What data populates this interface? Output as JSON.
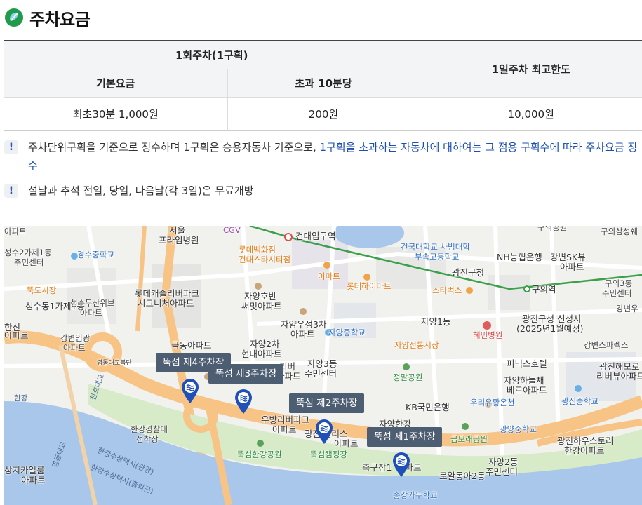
{
  "header": {
    "title": "주차요금"
  },
  "fee_table": {
    "group_header": "1회주차(1구획)",
    "daily_max_header": "1일주차 최고한도",
    "basic_fee_header": "기본요금",
    "extra_fee_header": "초과 10분당",
    "basic_fee_value": "최초30분 1,000원",
    "extra_fee_value": "200원",
    "daily_max_value": "10,000원"
  },
  "notes": {
    "note1_text": "주차단위구획을 기준으로 징수하며 1구획은 승용자동차 기준으로, ",
    "note1_highlight": "1구획을 초과하는 자동차에 대하여는 그 점용 구획수에 따라 주차요금 징수",
    "note2_text": "설날과 추석 전일, 당일, 다음날(각 3일)은 무료개방",
    "icon": "exclamation-icon"
  },
  "map": {
    "parking_lots": [
      "뚝섬 제4주차장",
      "뚝섬 제3주차장",
      "뚝섬 제2주차장",
      "뚝섬 제1주차장"
    ],
    "labels": {
      "l1": "아파트",
      "l2": "서울",
      "l3": "프라임병원",
      "l4": "CGV",
      "l5": "건대입구역",
      "l6": "구의공원",
      "l7": "구의삼성쉐",
      "l8": "성수2가제1동",
      "l9": "주민센터",
      "l10": "경수중학교",
      "l11": "롯데백화점",
      "l12": "건대스타시티점",
      "l13": "건국대학교 사범대학",
      "l14": "부속고등학교",
      "l15": "NH농협은행",
      "l16": "강변SK뷰",
      "l17": "아파트",
      "l18": "광진구청",
      "l19": "이마트",
      "l20": "롯데하이마트",
      "l21": "뚝도시장",
      "l22": "롯데캐슬리버파크",
      "l23": "시그니처아파트",
      "l24": "자양호반",
      "l25": "써밋아파트",
      "l26": "스타벅스",
      "l27": "구의역",
      "l28": "구의3동",
      "l29": "주민센터",
      "l30": "성수동1가제1동",
      "l31": "성수두산위브",
      "l32": "아파트",
      "l33": "강변우",
      "l34": "자양우성3차",
      "l35": "아파트",
      "l36": "자양1동",
      "l37": "광진구청 신청사",
      "l38": "(2025년1월예정)",
      "l39": "강변임광",
      "l40": "아파트",
      "l41": "자양중학교",
      "l42": "혜민병원",
      "l43": "극동아파트",
      "l44": "자양2차",
      "l45": "현대아파트",
      "l46": "자양전통시장",
      "l47": "강변스파렉스",
      "l48": "영동대교북단",
      "l49": "자양3동",
      "l50": "주민센터",
      "l51": "리버",
      "l52": "아파트",
      "l53": "피닉스호텔",
      "l54": "광진해모로",
      "l55": "리버뷰아파트",
      "l56": "자양하늘채",
      "l57": "베르아파트",
      "l58": "정말공원",
      "l59": "KB국민은행",
      "l60": "우리유황온천",
      "l61": "광진중학교",
      "l62": "우방리버파크",
      "l63": "아파트",
      "l64": "광진 플러스",
      "l65": "아파트",
      "l66": "한강경찰대",
      "l67": "선착장",
      "l68": "광양중학교",
      "l69": "금모래공원",
      "l70": "광진하우스토리",
      "l71": "한강아파트",
      "l72": "뚝섬한강공원",
      "l73": "뚝섬캠핑장",
      "l74": "축구장1",
      "l75": "자양2동",
      "l76": "주민센터",
      "l77": "로얄동아2동",
      "l78": "상지카일룸",
      "l79": "아파트",
      "l80": "한강수상택시(관광)",
      "l81": "한강수상택시(출퇴근)",
      "l82": "송강카누학교",
      "l83": "한강",
      "l84": "자양한강",
      "l85": "천호대교",
      "l86": "영동대교",
      "l87": "아파트",
      "l88": "한신",
      "l89": "아파트"
    }
  },
  "colors": {
    "accent_blue": "#1d4fb3",
    "map_road": "#f7c486",
    "map_river": "#a8c7ea",
    "map_park": "#d7ebc8",
    "pin_blue": "#1f4fb8",
    "subway_green": "#3aa04a"
  }
}
